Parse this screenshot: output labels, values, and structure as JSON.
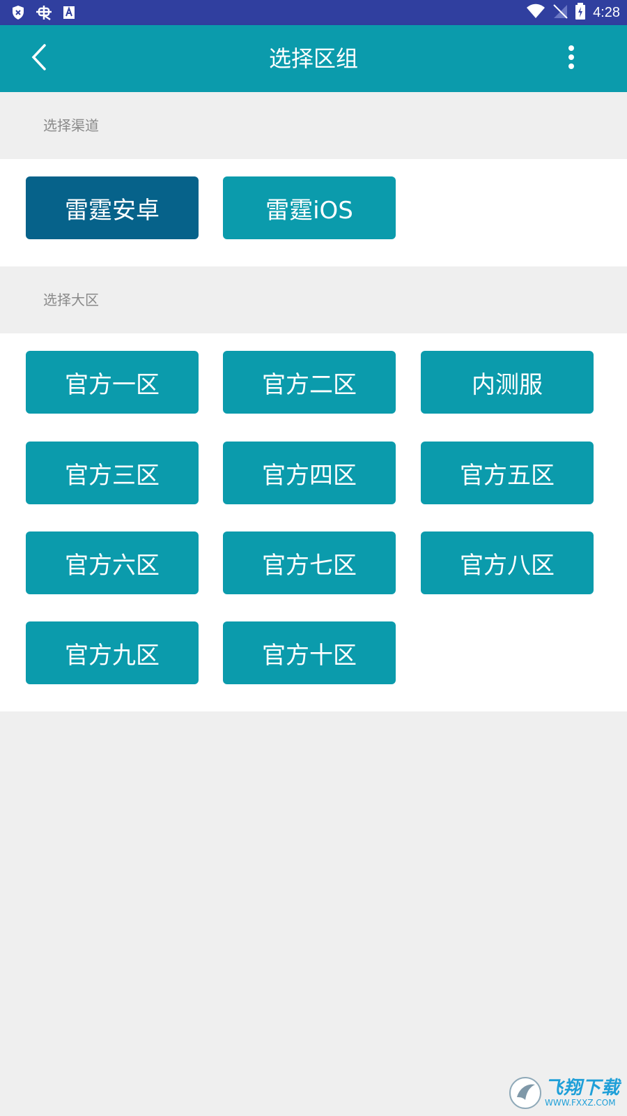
{
  "status_bar": {
    "time": "4:28",
    "left_icons": [
      "shield-icon",
      "bug-icon",
      "a-icon"
    ],
    "right_icons": [
      "wifi-icon",
      "no-signal-icon",
      "battery-charging-icon"
    ]
  },
  "app_bar": {
    "title": "选择区组",
    "back_icon": "back-arrow-icon",
    "more_icon": "more-vert-icon"
  },
  "channel_section": {
    "header": "选择渠道",
    "buttons": [
      {
        "label": "雷霆安卓",
        "selected": true
      },
      {
        "label": "雷霆iOS",
        "selected": false
      }
    ]
  },
  "region_section": {
    "header": "选择大区",
    "buttons": [
      {
        "label": "官方一区"
      },
      {
        "label": "官方二区"
      },
      {
        "label": "内测服"
      },
      {
        "label": "官方三区"
      },
      {
        "label": "官方四区"
      },
      {
        "label": "官方五区"
      },
      {
        "label": "官方六区"
      },
      {
        "label": "官方七区"
      },
      {
        "label": "官方八区"
      },
      {
        "label": "官方九区"
      },
      {
        "label": "官方十区"
      }
    ]
  },
  "watermark": {
    "brand": "飞翔下载",
    "url": "WWW.FXXZ.COM"
  },
  "colors": {
    "status_bar": "#303f9f",
    "app_bar": "#0b9bac",
    "button": "#0b9bac",
    "button_selected": "#06628a",
    "background": "#efefef"
  }
}
